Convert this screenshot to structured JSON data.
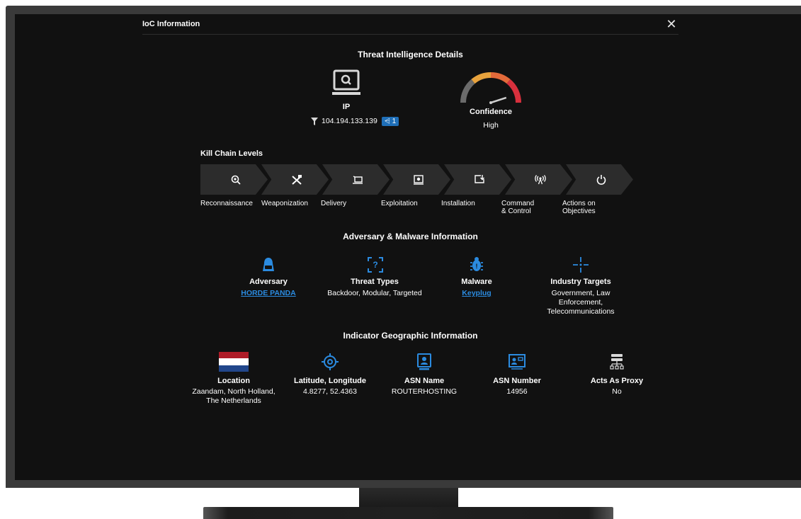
{
  "modal": {
    "title": "IoC Information",
    "close_glyph": "✕"
  },
  "threat": {
    "section_title": "Threat Intelligence Details",
    "indicator_type": "IP",
    "indicator_value": "104.194.133.139",
    "share_count": "1",
    "confidence_label": "Confidence",
    "confidence_value": "High",
    "confidence_level": 0.8
  },
  "kill_chain": {
    "title": "Kill Chain Levels",
    "stages": [
      {
        "label_line1": "Reconnaissance",
        "label_line2": "",
        "icon": "magnify-target-icon"
      },
      {
        "label_line1": "Weaponization",
        "label_line2": "",
        "icon": "crossed-tools-icon"
      },
      {
        "label_line1": "Delivery",
        "label_line2": "",
        "icon": "delivery-cart-icon"
      },
      {
        "label_line1": "Exploitation",
        "label_line2": "",
        "icon": "bug-screen-icon"
      },
      {
        "label_line1": "Installation",
        "label_line2": "",
        "icon": "install-icon"
      },
      {
        "label_line1": "Command",
        "label_line2": "& Control",
        "icon": "broadcast-icon"
      },
      {
        "label_line1": "Actions on",
        "label_line2": "Objectives",
        "icon": "power-icon"
      }
    ]
  },
  "adversary": {
    "section_title": "Adversary & Malware Information",
    "adversary_label": "Adversary",
    "adversary_value": "HORDE PANDA",
    "threat_types_label": "Threat Types",
    "threat_types_value": "Backdoor, Modular, Targeted",
    "malware_label": "Malware",
    "malware_value": "Keyplug",
    "industry_label": "Industry Targets",
    "industry_line1": "Government, Law",
    "industry_line2": "Enforcement,",
    "industry_line3": "Telecommunications",
    "accent_color": "#2b8be0"
  },
  "geo": {
    "section_title": "Indicator Geographic Information",
    "location_label": "Location",
    "location_line1": "Zaandam, North Holland,",
    "location_line2": "The Netherlands",
    "latlong_label": "Latitude, Longitude",
    "latlong_value": "4.8277, 52.4363",
    "asn_name_label": "ASN Name",
    "asn_name_value": "ROUTERHOSTING",
    "asn_number_label": "ASN Number",
    "asn_number_value": "14956",
    "proxy_label": "Acts As Proxy",
    "proxy_value": "No",
    "flag_colors": [
      "#ae1c28",
      "#ffffff",
      "#21468b"
    ]
  }
}
